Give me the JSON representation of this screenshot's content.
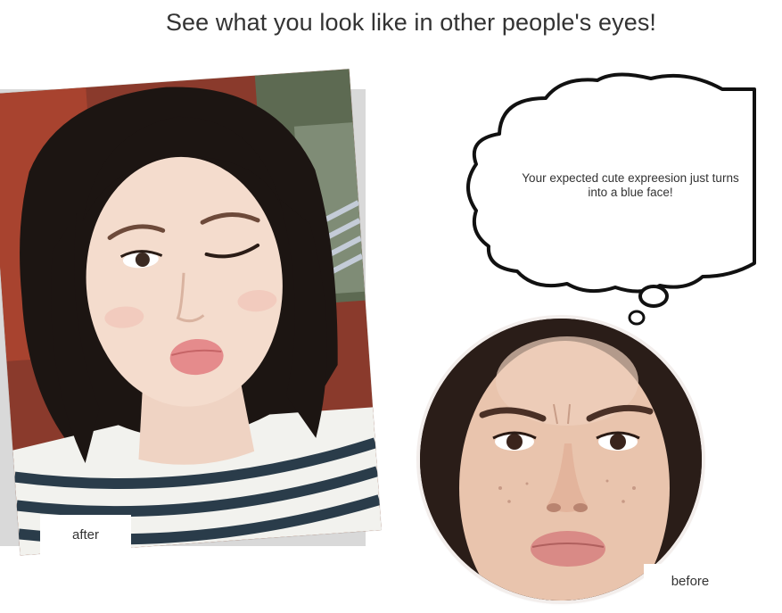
{
  "headline": "See what you look like in other people's eyes!",
  "after_photo": {
    "label": "after",
    "icon": "winking-kiss-selfie-photo"
  },
  "thought_bubble": {
    "text": "Your expected cute expreesion just turns into a blue face!",
    "icon": "thought-cloud-icon"
  },
  "before_photo": {
    "label": "before",
    "icon": "frowning-pout-portrait-photo"
  },
  "colors": {
    "text": "#333333",
    "photo_shadow": "#d9d9d9",
    "background": "#ffffff"
  }
}
